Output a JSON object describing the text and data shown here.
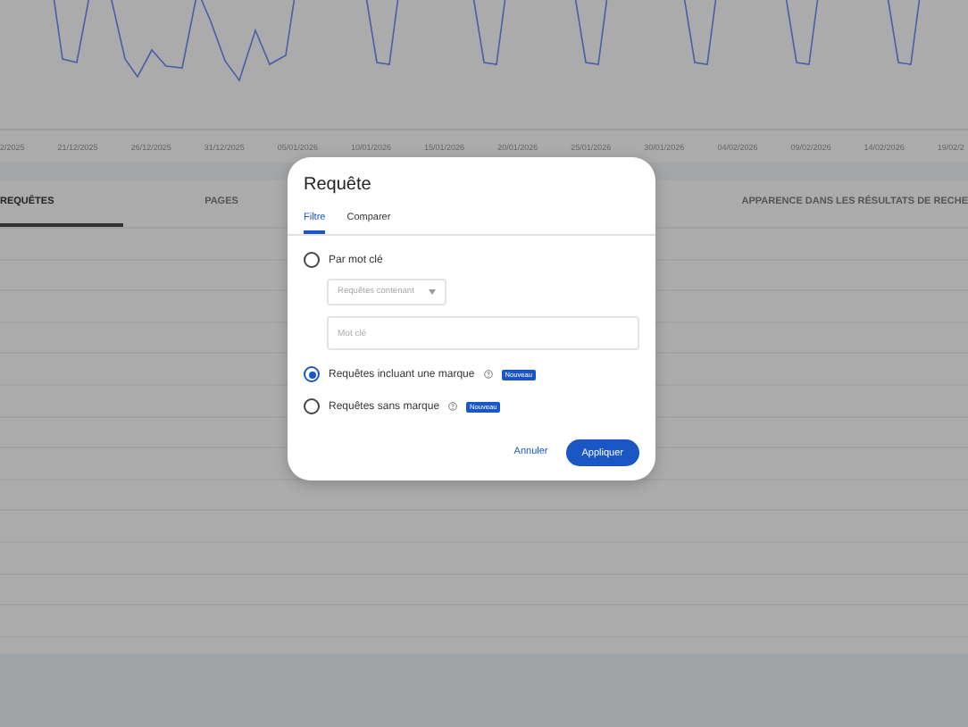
{
  "chart": {
    "date_labels": [
      "2/2025",
      "21/12/2025",
      "26/12/2025",
      "31/12/2025",
      "05/01/2026",
      "10/01/2026",
      "15/01/2026",
      "20/01/2026",
      "25/01/2026",
      "30/01/2026",
      "04/02/2026",
      "09/02/2026",
      "14/02/2026",
      "19/02/2"
    ]
  },
  "tabs": [
    {
      "label": "REQUÊTES",
      "selected": true
    },
    {
      "label": "PAGES",
      "selected": false
    },
    {
      "label": "APPARENCE DANS LES RÉSULTATS DE RECHE",
      "selected": false
    }
  ],
  "dialog": {
    "title": "Requête",
    "tabs": [
      {
        "label": "Filtre",
        "selected": true
      },
      {
        "label": "Comparer",
        "selected": false
      }
    ],
    "options": [
      {
        "label": "Par mot clé",
        "selected": false,
        "help": false,
        "select": {
          "value": "Requêtes contenant"
        },
        "keyword_field": {
          "placeholder": "Mot clé"
        }
      },
      {
        "label": "Requêtes incluant une marque",
        "selected": true,
        "help": true,
        "badge": "Nouveau"
      },
      {
        "label": "Requêtes sans marque",
        "selected": false,
        "help": true,
        "badge": "Nouveau"
      }
    ],
    "buttons": [
      {
        "label": "Annuler",
        "kind": "text"
      },
      {
        "label": "Appliquer",
        "kind": "filled"
      }
    ]
  }
}
